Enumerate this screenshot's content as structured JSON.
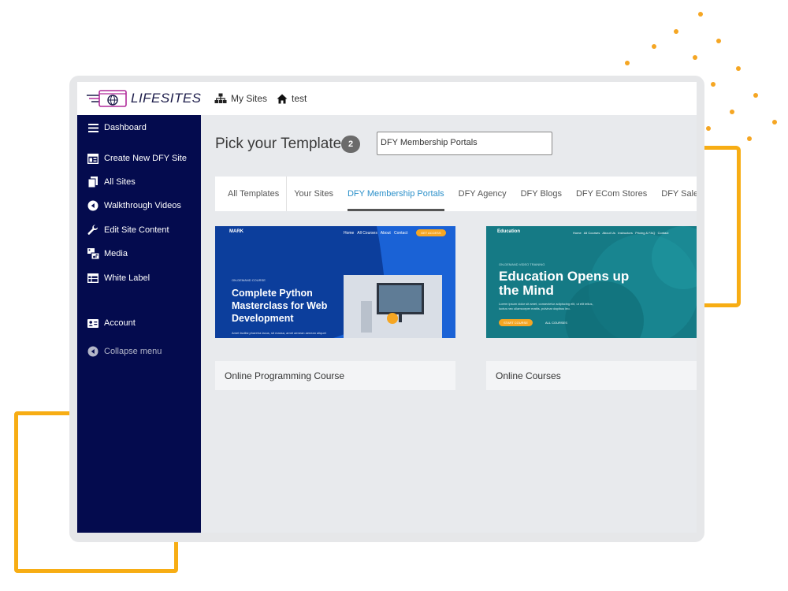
{
  "brand": {
    "logo_text": "LIFESITES"
  },
  "topnav": [
    {
      "label": "My Sites",
      "icon": "sitemap-icon"
    },
    {
      "label": "test",
      "icon": "home-icon"
    }
  ],
  "sidebar": {
    "items": [
      {
        "label": "Dashboard",
        "icon": "menu-icon"
      },
      {
        "label": "Create New DFY Site",
        "icon": "layout-icon"
      },
      {
        "label": "All Sites",
        "icon": "copy-icon"
      },
      {
        "label": "Walkthrough Videos",
        "icon": "play-circle-icon"
      },
      {
        "label": "Edit Site Content",
        "icon": "wrench-icon"
      },
      {
        "label": "Media",
        "icon": "photo-video-icon"
      },
      {
        "label": "White Label",
        "icon": "table-icon"
      },
      {
        "label": "Account",
        "icon": "id-card-icon"
      }
    ],
    "collapse_label": "Collapse menu"
  },
  "main": {
    "title": "Pick your Template",
    "badge": "2",
    "select_value": "DFY Membership Portals",
    "tabs": [
      {
        "label": "All Templates"
      },
      {
        "label": "Your Sites"
      },
      {
        "label": "DFY Membership Portals",
        "active": true
      },
      {
        "label": "DFY Agency"
      },
      {
        "label": "DFY Blogs"
      },
      {
        "label": "DFY ECom Stores"
      },
      {
        "label": "DFY Sales Funnels"
      }
    ],
    "cards": [
      {
        "label": "Online Programming Course",
        "preview": {
          "brand": "MARK",
          "nav": [
            "Home",
            "All Courses",
            "About",
            "Contact"
          ],
          "button": "GET ACCESS",
          "eyebrow": "ON-DEMAND COURSE",
          "headline": "Complete Python Masterclass for Web Development",
          "body": "Amet facilisi pharetra lacus, sit massa, amet aenean aenean aliquet"
        }
      },
      {
        "label": "Online Courses",
        "preview": {
          "brand": "Education",
          "nav": [
            "Home",
            "All Courses",
            "About Us",
            "Instructors",
            "Pricing & FAQ",
            "Contact"
          ],
          "eyebrow": "ON-DEMAND VIDEO TRAINING",
          "headline": "Education Opens up the Mind",
          "body": "Lorem ipsum dolor sit amet, consectetur adipiscing elit, ut elit tellus, luctus nec ullamcorper mattis, pulvinar dapibus leo.",
          "button": "START COURSE",
          "link": "ALL COURSES"
        }
      }
    ]
  },
  "colors": {
    "sidebar_bg": "#040b4e",
    "accent_blue": "#2a8fc9",
    "accent_orange": "#f7ad14"
  }
}
